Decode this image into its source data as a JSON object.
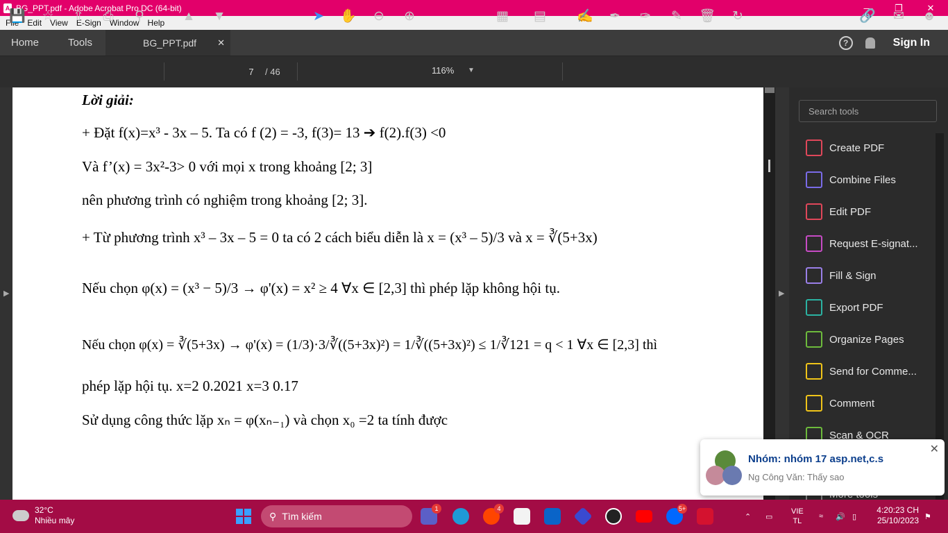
{
  "window": {
    "title": "BG_PPT.pdf - Adobe Acrobat Pro DC (64-bit)"
  },
  "menu": [
    "File",
    "Edit",
    "View",
    "E-Sign",
    "Window",
    "Help"
  ],
  "tabs": {
    "home": "Home",
    "tools": "Tools",
    "document": "BG_PPT.pdf"
  },
  "header": {
    "sign_in": "Sign In"
  },
  "toolbar": {
    "current_page": "7",
    "total_pages": "/ 46",
    "zoom": "116%"
  },
  "document": {
    "heading": "Lời giải:",
    "line1": "+ Đặt f(x)=x³ - 3x – 5. Ta có f (2) = -3, f(3)= 13 ➔ f(2).f(3) <0",
    "line2": "Và f’(x) = 3x²-3> 0 với mọi x trong khoảng [2; 3]",
    "line3": "nên phương trình có nghiệm trong khoảng [2; 3].",
    "line4": "+ Từ phương trình x³ – 3x – 5 = 0 ta có 2 cách biểu diễn là x = (x³ – 5)/3  và  x = ∛(5+3x)",
    "line5": "Nếu chọn  φ(x) = (x³ − 5)/3 → φ'(x) = x² ≥ 4    ∀x ∈ [2,3]  thì phép lặp không hội tụ.",
    "line6": "Nếu  chọn  φ(x) = ∛(5+3x) → φ'(x) = (1/3)·3/∛((5+3x)²) = 1/∛((5+3x)²) ≤ 1/∛121 = q < 1    ∀x ∈ [2,3]   thì",
    "line7": "phép lặp hội tụ. x=2  0.2021    x=3    0.17",
    "line8": "Sử dụng công thức lặp xₙ = φ(xₙ₋₁)  và chọn x₀ =2 ta tính được"
  },
  "tools_panel": {
    "search_placeholder": "Search tools",
    "items": [
      {
        "label": "Create PDF",
        "color": "#e0475a"
      },
      {
        "label": "Combine Files",
        "color": "#7a6be8"
      },
      {
        "label": "Edit PDF",
        "color": "#e0475a"
      },
      {
        "label": "Request E-signat...",
        "color": "#c74bc5"
      },
      {
        "label": "Fill & Sign",
        "color": "#9a7fe8"
      },
      {
        "label": "Export PDF",
        "color": "#2bb3a2"
      },
      {
        "label": "Organize Pages",
        "color": "#6dbb3c"
      },
      {
        "label": "Send for Comme...",
        "color": "#f0c419"
      },
      {
        "label": "Comment",
        "color": "#f0c419"
      },
      {
        "label": "Scan & OCR",
        "color": "#6dbb3c"
      },
      {
        "label": "More tools",
        "color": "#888888"
      }
    ]
  },
  "notification": {
    "title": "Nhóm: nhóm 17 asp.net,c.s",
    "message": "Ng Công Văn: Thấy sao"
  },
  "taskbar": {
    "temperature": "32°C",
    "weather": "Nhiều mây",
    "search": "Tìm kiếm",
    "lang_top": "VIE",
    "lang_bottom": "TL",
    "time": "4:20:23 CH",
    "date": "25/10/2023",
    "badges": {
      "teams": "1",
      "reddit": "4",
      "zalo": "5+"
    }
  }
}
